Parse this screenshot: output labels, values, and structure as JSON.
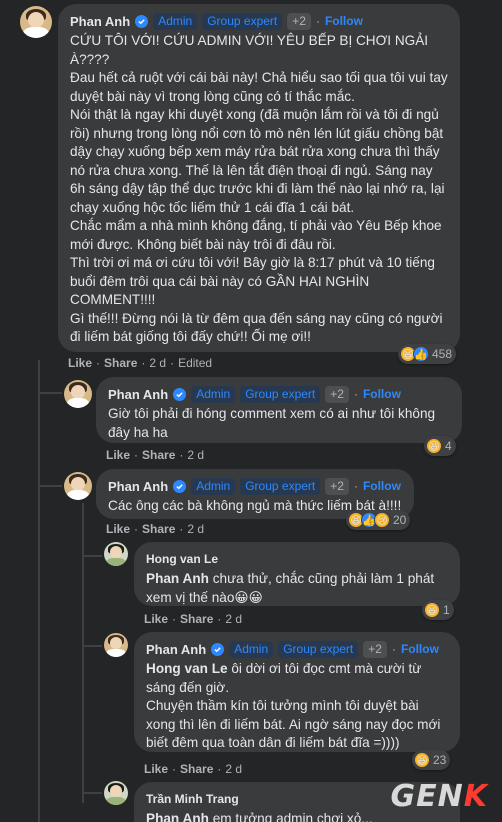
{
  "comments": [
    {
      "author": "Phan Anh",
      "badges": [
        "Admin",
        "Group expert",
        "+2"
      ],
      "follow": "Follow",
      "paragraphs": [
        "CỨU TÔI VỚI! CỨU ADMIN VỚI! YÊU BẾP BỊ CHƠI NGẢI À????",
        "Đau hết cả ruột với cái bài này! Chả hiểu sao tối qua tôi vui tay duyệt bài này vì trong lòng cũng có tí thắc mắc.",
        "Nói thật là ngay khi duyệt xong (đã muộn lắm rồi và tôi đi ngủ rồi) nhưng trong lòng nổi cơn tò mò nên lén lút giấu chồng bật dậy chạy xuống bếp xem máy rửa bát rửa xong chưa thì thấy nó rửa chưa xong. Thế là lên tắt điện thoại đi ngủ. Sáng nay 6h sáng dậy tập thể dục trước khi đi làm thế nào lại nhớ ra, lại chạy xuống hộc tốc liếm thử 1 cái đĩa 1 cái bát.",
        "Chắc mẩm a nhà mình không đắng, tí phải vào Yêu Bếp khoe mới được. Không biết bài này trôi đi đâu rồi.",
        "Thì trời ơi má ơi cứu tôi với! Bây giờ là 8:17 phút và 10 tiếng buổi đêm trôi qua cái bài này có GẦN HAI NGHÌN COMMENT!!!!",
        "Gì thế!!! Đừng nói là từ đêm qua đến sáng nay cũng có người đi liếm bát giống tôi đấy chứ!! Ối mẹ ơi!!"
      ],
      "actions": {
        "like": "Like",
        "share": "Share",
        "time": "2 d",
        "edited": "Edited"
      },
      "reaction_count": "458"
    },
    {
      "author": "Phan Anh",
      "badges": [
        "Admin",
        "Group expert",
        "+2"
      ],
      "follow": "Follow",
      "text": "Giờ tôi phải đi hóng comment xem có ai như tôi không đây ha ha",
      "actions": {
        "like": "Like",
        "share": "Share",
        "time": "2 d"
      },
      "reaction_count": "4"
    },
    {
      "author": "Phan Anh",
      "badges": [
        "Admin",
        "Group expert",
        "+2"
      ],
      "follow": "Follow",
      "text": "Các ông các bà không ngủ mà thức liếm bát à!!!!",
      "actions": {
        "like": "Like",
        "share": "Share",
        "time": "2 d"
      },
      "reaction_count": "20"
    },
    {
      "author": "Hong van Le",
      "mention": "Phan Anh",
      "text": " chưa thử, chắc cũng phải làm 1 phát xem vị thế nào😀😀",
      "actions": {
        "like": "Like",
        "share": "Share",
        "time": "2 d"
      },
      "reaction_count": "1"
    },
    {
      "author": "Phan Anh",
      "badges": [
        "Admin",
        "Group expert",
        "+2"
      ],
      "follow": "Follow",
      "mention": "Hong van Le",
      "text": " ôi dời ơi tôi đọc cmt mà cười từ sáng đến giờ.",
      "text2": "Chuyện thầm kín tôi tưởng mình tôi duyệt bài xong thì lên đi liếm bát. Ai ngờ sáng nay đọc mới biết đêm qua toàn dân đi liếm bát đĩa =))))",
      "actions": {
        "like": "Like",
        "share": "Share",
        "time": "2 d"
      },
      "reaction_count": "23"
    },
    {
      "author": "Trần Minh Trang",
      "mention": "Phan Anh",
      "text": " em tưởng admin chơi xỏ..."
    }
  ],
  "watermark": {
    "part1": "GEN",
    "part2": "K"
  }
}
